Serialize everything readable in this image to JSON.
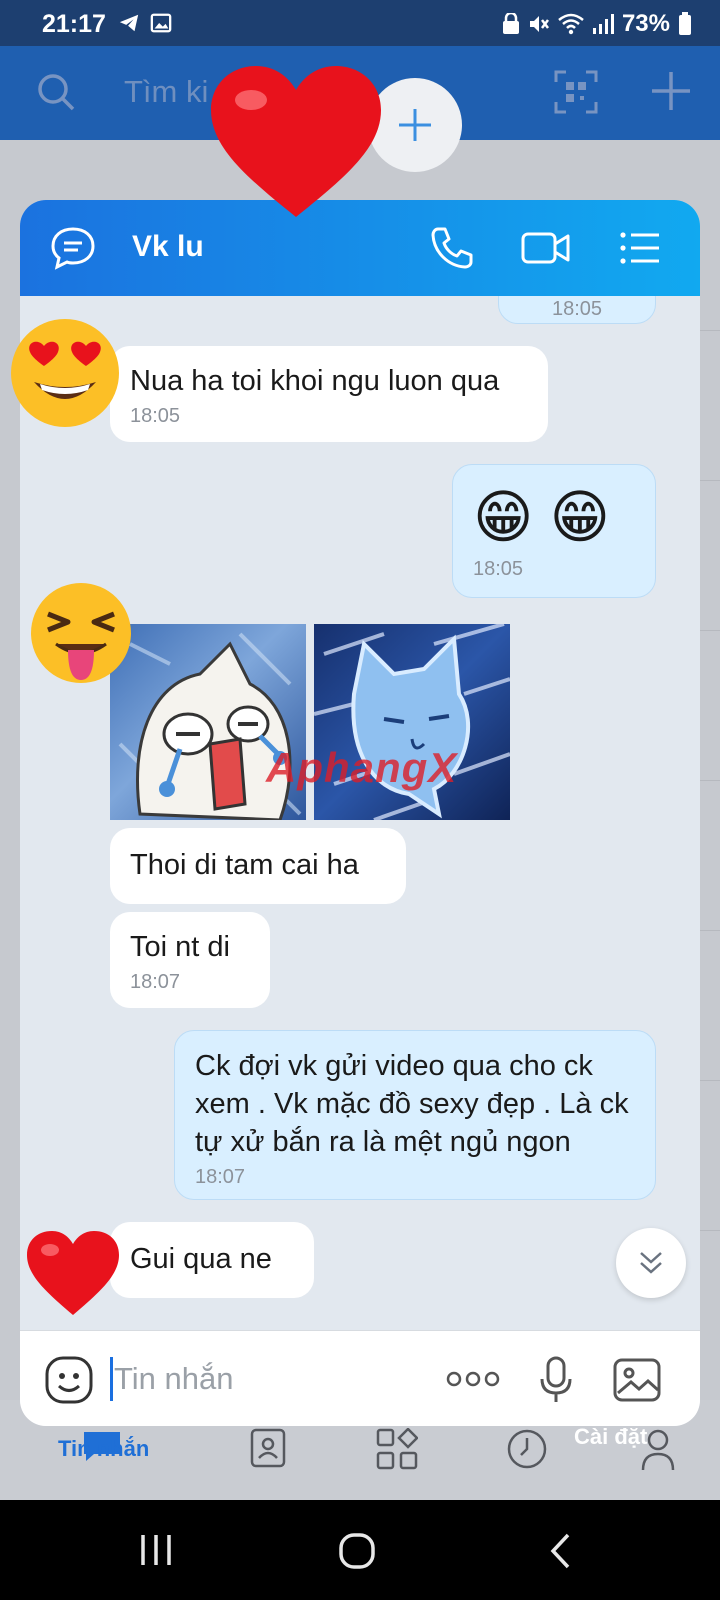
{
  "status_bar": {
    "time": "21:17",
    "battery": "73%",
    "icons": [
      "telegram-icon",
      "gallery-icon",
      "lock-icon",
      "mute-icon",
      "wifi-icon",
      "signal-icon",
      "battery-icon"
    ]
  },
  "background_app": {
    "search_placeholder": "Tìm ki",
    "nav": {
      "messages_label": "Tin nhắn",
      "settings_label": "Cài đặt"
    }
  },
  "chat": {
    "title": "Vk lu",
    "header_icons": [
      "chat-bubble-icon",
      "phone-icon",
      "video-call-icon",
      "menu-list-icon"
    ],
    "messages": [
      {
        "dir": "out",
        "text": "",
        "time": "18:05"
      },
      {
        "dir": "in",
        "text": "Nua ha toi khoi ngu luon qua",
        "time": "18:05"
      },
      {
        "dir": "out",
        "text": "😁 😁",
        "time": "18:05"
      },
      {
        "dir": "in",
        "text": "Thoi di tam cai ha",
        "time": ""
      },
      {
        "dir": "in",
        "text": "Toi nt di",
        "time": "18:07"
      },
      {
        "dir": "out",
        "text": "Ck đợi vk gửi video qua cho ck xem . Vk mặc đồ sexy đẹp . Là ck tự xử bắn ra là mệt ngủ ngon",
        "time": "18:07"
      },
      {
        "dir": "in",
        "text": "Gui qua ne",
        "time": ""
      }
    ],
    "sticker_watermark": "AphangX",
    "input_placeholder": "Tin nhắn",
    "reactions": [
      "heart-emoji",
      "heart-eyes-emoji",
      "tongue-squint-emoji",
      "heart-emoji"
    ]
  },
  "colors": {
    "header_gradient_start": "#1b72df",
    "header_gradient_end": "#11a9f0",
    "outgoing_bubble": "#d9efff",
    "incoming_bubble": "#ffffff",
    "accent": "#1a6fe0"
  }
}
